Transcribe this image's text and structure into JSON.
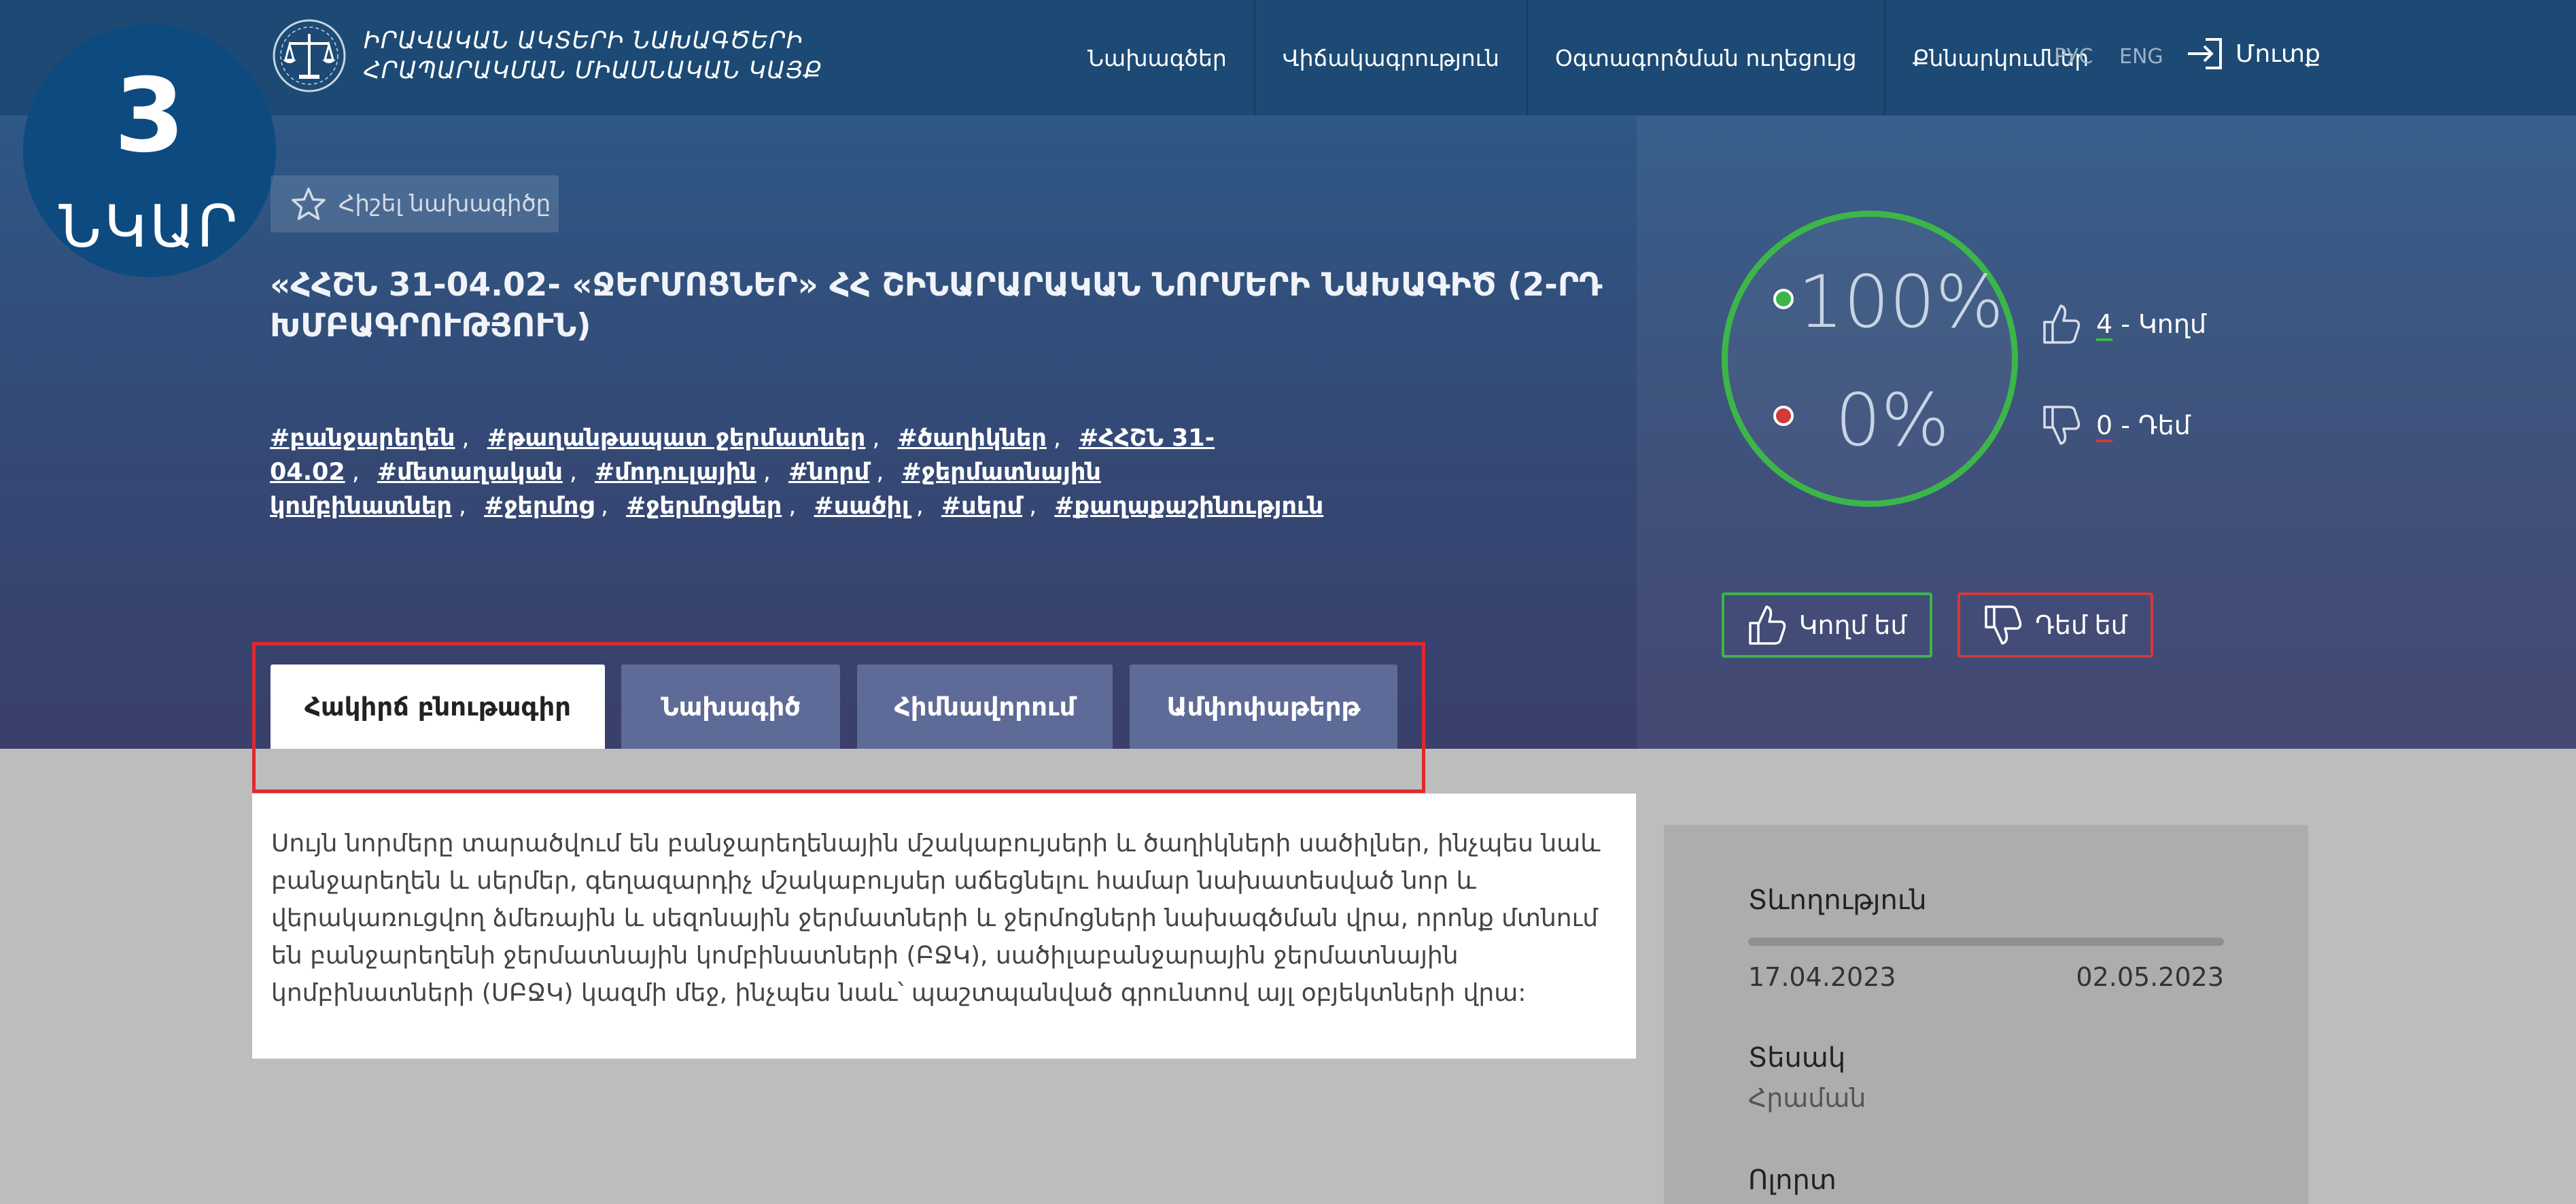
{
  "header": {
    "logo_line1": "ԻՐԱՎԱԿԱՆ ԱԿՏԵՐԻ ՆԱԽԱԳԾԵՐԻ",
    "logo_line2": "ՀՐԱՊԱՐԱԿՄԱՆ ՄԻԱՍՆԱԿԱՆ ԿԱՅՔ",
    "nav": [
      "Նախագծեր",
      "Վիճակագրություն",
      "Օգտագործման ուղեցույց",
      "Քննարկումներ"
    ],
    "lang_ru": "РУС",
    "lang_en": "ENG",
    "login": "Մուտք"
  },
  "badge": {
    "number": "3",
    "word": "ՆԿԱՐ"
  },
  "bookmark_label": "Հիշել նախագիծը",
  "title": "«ՀՀՇՆ 31-04.02- «ՋԵՐՄՈՑՆԵՐ» ՀՀ ՇԻՆԱՐԱՐԱԿԱՆ ՆՈՐՄԵՐԻ ՆԱԽԱԳԻԾ (2-ՐԴ ԽՄԲԱԳՐՈՒԹՅՈՒՆ)",
  "tags": [
    "#բանջարեղեն",
    "#թաղանթապատ ջերմատներ",
    "#ծաղիկներ",
    "#ՀՀՇՆ 31-04.02",
    "#մետաղական",
    "#մոդուլային",
    "#նորմ",
    "#ջերմատնային կոմբինատներ",
    "#ջերմոց",
    "#ջերմոցներ",
    "#սածիլ",
    "#սերմ",
    "#քաղաքաշինություն"
  ],
  "votes": {
    "for_pct": "100%",
    "against_pct": "0%",
    "for_pct_value": 100,
    "for_count": "4",
    "for_label": "- Կողմ",
    "against_count": "0",
    "against_label": "- Դեմ",
    "for_button": "Կողմ եմ",
    "against_button": "Դեմ եմ",
    "for_color": "#3cb649",
    "against_color": "#d03a3a"
  },
  "tabs": [
    "Հակիրճ բնութագիր",
    "Նախագիծ",
    "Հիմնավորում",
    "Ամփոփաթերթ"
  ],
  "content": {
    "paragraph": "Սույն նորմերը տարածվում են բանջարեղենային մշակաբույսերի և ծաղիկների սածիլներ, ինչպես նաև բանջարեղեն և սերմեր, գեղազարդիչ մշակաբույսեր աճեցնելու համար նախատեսված նոր և վերակառուցվող ձմեռային և սեզոնային ջերմատների և ջերմոցների նախագծման վրա, որոնք մտնում են բանջարեղենի ջերմատնային կոմբինատների (ԲՋԿ), սածիլաբանջարային ջերմատնային կոմբինատների (ՍԲՋԿ) կազմի մեջ, ինչպես նաև՝ պաշտպանված գրունտով այլ օբյեկտների վրա:"
  },
  "sidebar": {
    "duration_label": "Տևողություն",
    "duration_progress": 0.0,
    "date_start": "17.04.2023",
    "date_end": "02.05.2023",
    "type_label": "Տեսակ",
    "type_value": "Հրաման",
    "area_label": "Ոլորտ"
  }
}
